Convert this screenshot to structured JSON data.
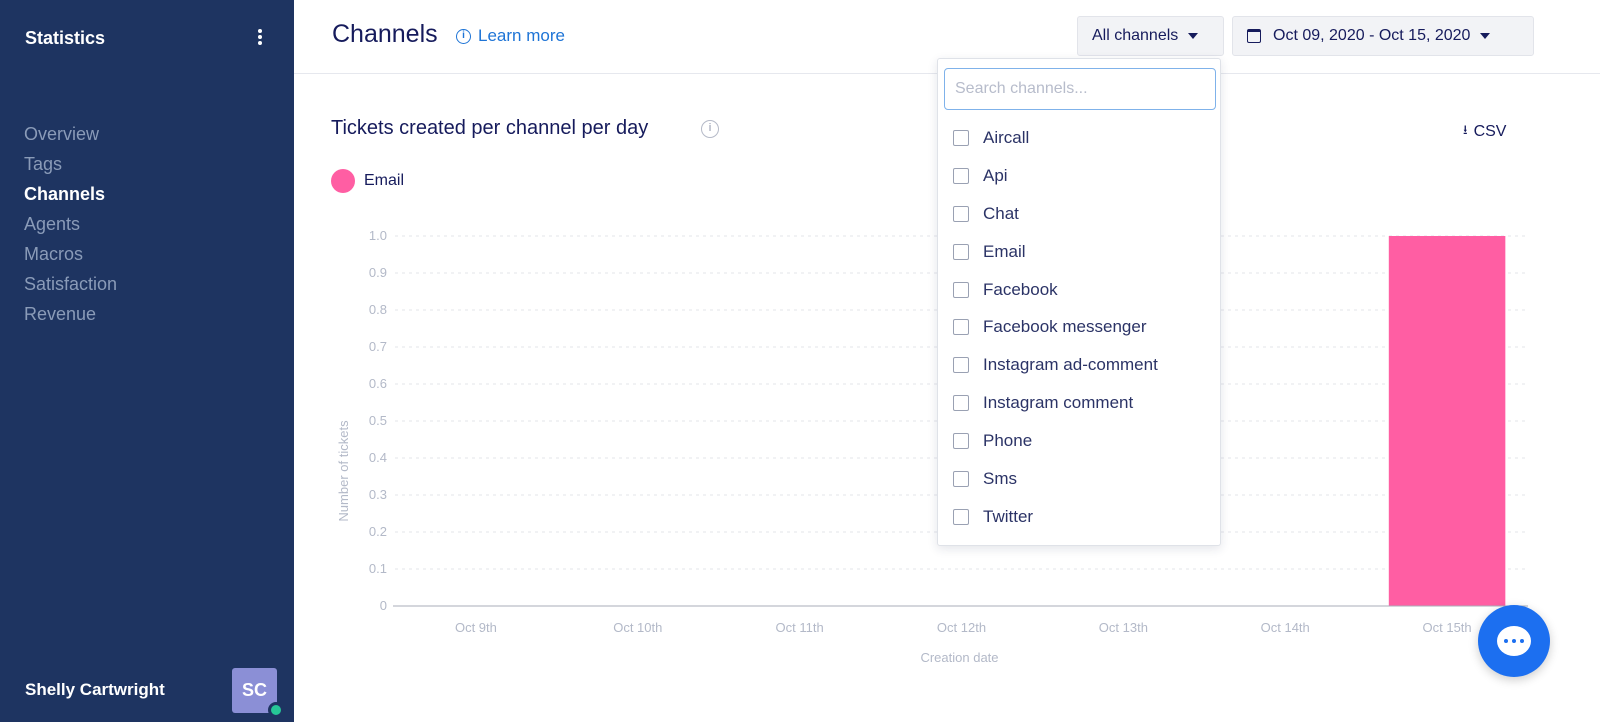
{
  "sidebar": {
    "title": "Statistics",
    "items": [
      {
        "label": "Overview",
        "active": false
      },
      {
        "label": "Tags",
        "active": false
      },
      {
        "label": "Channels",
        "active": true
      },
      {
        "label": "Agents",
        "active": false
      },
      {
        "label": "Macros",
        "active": false
      },
      {
        "label": "Satisfaction",
        "active": false
      },
      {
        "label": "Revenue",
        "active": false
      }
    ],
    "user": {
      "name": "Shelly Cartwright",
      "initials": "SC",
      "status_color": "#26c797"
    }
  },
  "header": {
    "title": "Channels",
    "learn_more": "Learn more",
    "channel_filter": "All channels",
    "date_range": "Oct 09, 2020 - Oct 15, 2020"
  },
  "chart_panel": {
    "csv_label": "CSV"
  },
  "dropdown": {
    "placeholder": "Search channels...",
    "options": [
      "Aircall",
      "Api",
      "Chat",
      "Email",
      "Facebook",
      "Facebook messenger",
      "Instagram ad-comment",
      "Instagram comment",
      "Phone",
      "Sms",
      "Twitter"
    ]
  },
  "colors": {
    "sidebar_bg": "#1e3461",
    "accent": "#1e74d6",
    "email_series": "#ff5ea3",
    "chat_launcher": "#1c6ff0"
  },
  "chart_data": {
    "type": "bar",
    "title": "Tickets created per channel per day",
    "xlabel": "Creation date",
    "ylabel": "Number of tickets",
    "categories": [
      "Oct 9th",
      "Oct 10th",
      "Oct 11th",
      "Oct 12th",
      "Oct 13th",
      "Oct 14th",
      "Oct 15th"
    ],
    "series": [
      {
        "name": "Email",
        "color": "#ff5ea3",
        "values": [
          0,
          0,
          0,
          0,
          0,
          0,
          1
        ]
      }
    ],
    "ylim": [
      0,
      1
    ],
    "yticks": [
      "0",
      "0.1",
      "0.2",
      "0.3",
      "0.4",
      "0.5",
      "0.6",
      "0.7",
      "0.8",
      "0.9",
      "1.0"
    ],
    "grid": true,
    "legend": "top-left"
  }
}
